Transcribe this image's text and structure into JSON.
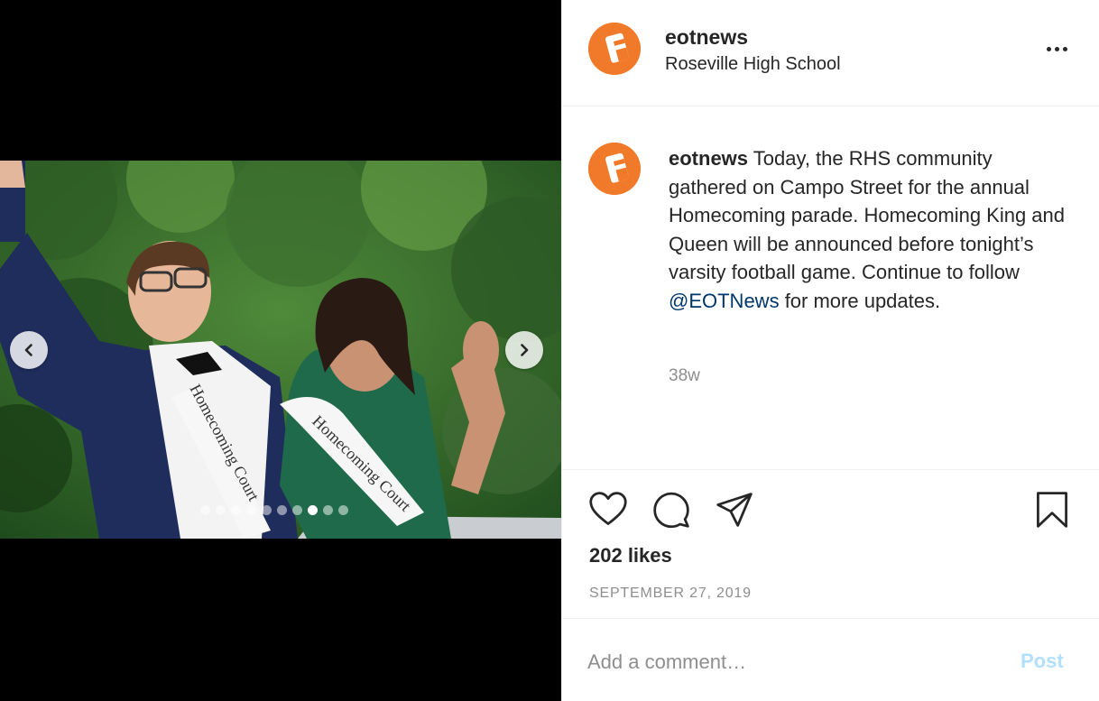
{
  "post": {
    "username": "eotnews",
    "location": "Roseville High School",
    "caption_user": "eotnews",
    "caption_text": " Today, the RHS community gathered on Campo Street for the annual Homecoming parade. Homecoming King and Queen will be announced before tonight’s varsity football game. Continue to follow ",
    "caption_mention": "@EOTNews",
    "caption_tail": " for more updates.",
    "time_ago": "38w",
    "likes": "202 likes",
    "date": "SEPTEMBER 27, 2019"
  },
  "photo": {
    "sash_text": "Homecoming Court",
    "carousel_total": 10,
    "carousel_active_index": 7
  },
  "comment": {
    "placeholder": "Add a comment…",
    "post_label": "Post"
  },
  "icons": {
    "more": "more-options-icon",
    "like": "heart-icon",
    "comment": "speech-bubble-icon",
    "share": "paper-plane-icon",
    "save": "bookmark-icon",
    "prev": "chevron-left-icon",
    "next": "chevron-right-icon"
  },
  "colors": {
    "brand_orange": "#f07a2a",
    "mention": "#00376b",
    "muted": "#8e8e8e",
    "post_disabled": "#b2dffc"
  }
}
